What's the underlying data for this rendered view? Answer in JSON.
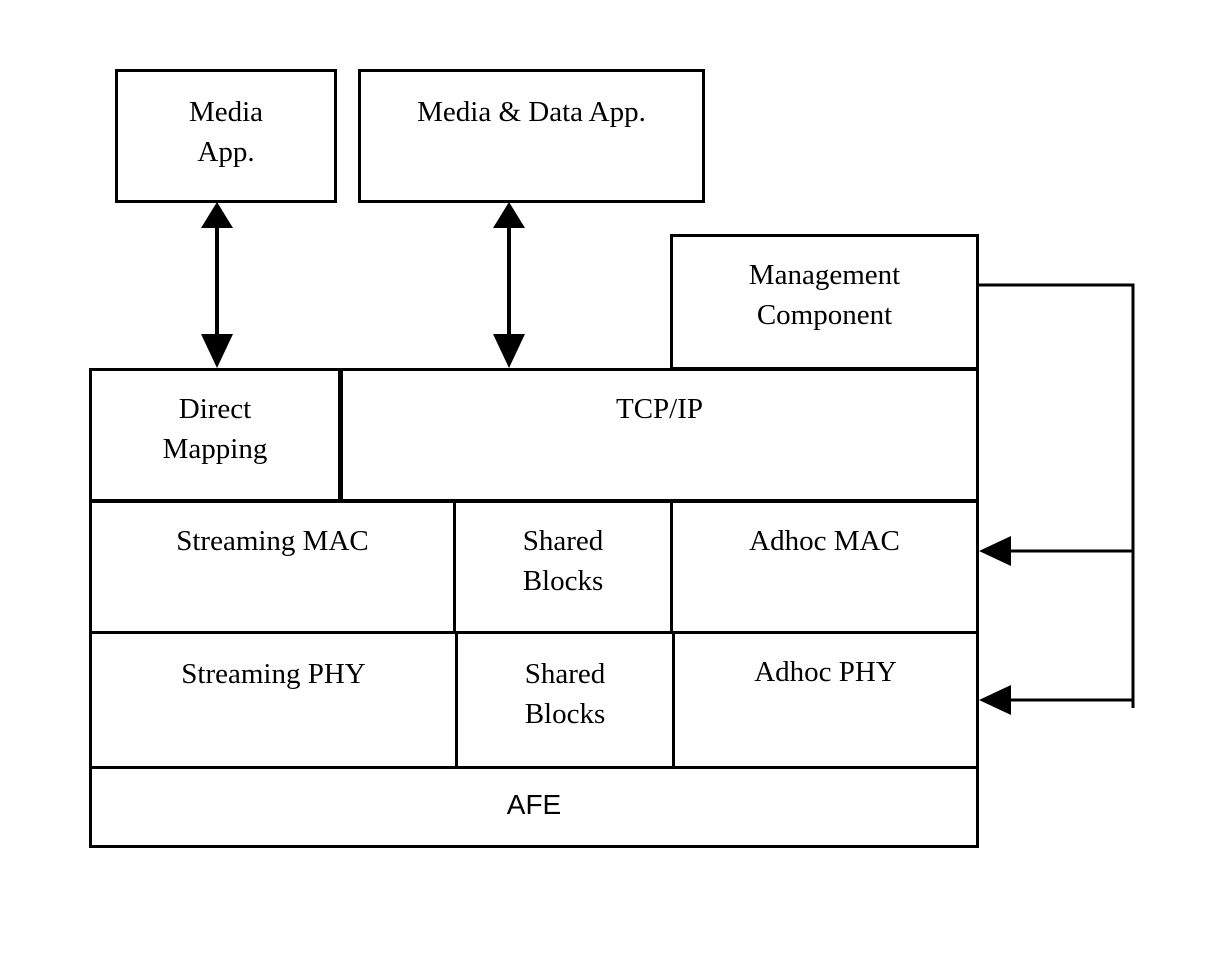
{
  "diagram": {
    "type": "layered-architecture",
    "blocks": {
      "media_app": {
        "lines": [
          "Media",
          "App."
        ]
      },
      "media_data_app": {
        "lines": [
          "Media & Data App."
        ]
      },
      "management_component": {
        "lines": [
          "Management",
          "Component"
        ]
      },
      "direct_mapping": {
        "lines": [
          "Direct",
          "Mapping"
        ]
      },
      "tcp_ip": {
        "lines": [
          "TCP/IP"
        ]
      },
      "streaming_mac": {
        "lines": [
          "Streaming MAC"
        ]
      },
      "shared_blocks_mac": {
        "lines": [
          "Shared",
          "Blocks"
        ]
      },
      "adhoc_mac": {
        "lines": [
          "Adhoc MAC"
        ]
      },
      "streaming_phy": {
        "lines": [
          "Streaming PHY"
        ]
      },
      "shared_blocks_phy": {
        "lines": [
          "Shared",
          "Blocks"
        ]
      },
      "adhoc_phy": {
        "lines": [
          "Adhoc PHY"
        ]
      },
      "afe": {
        "lines": [
          "AFE"
        ]
      }
    },
    "connections": [
      {
        "from": "Media App.",
        "to": "Direct Mapping",
        "kind": "bidirectional"
      },
      {
        "from": "Media & Data App.",
        "to": "TCP/IP",
        "kind": "bidirectional"
      },
      {
        "from": "Management Component",
        "to": "Adhoc MAC",
        "kind": "directed"
      },
      {
        "from": "Management Component",
        "to": "Adhoc PHY",
        "kind": "directed"
      }
    ]
  }
}
